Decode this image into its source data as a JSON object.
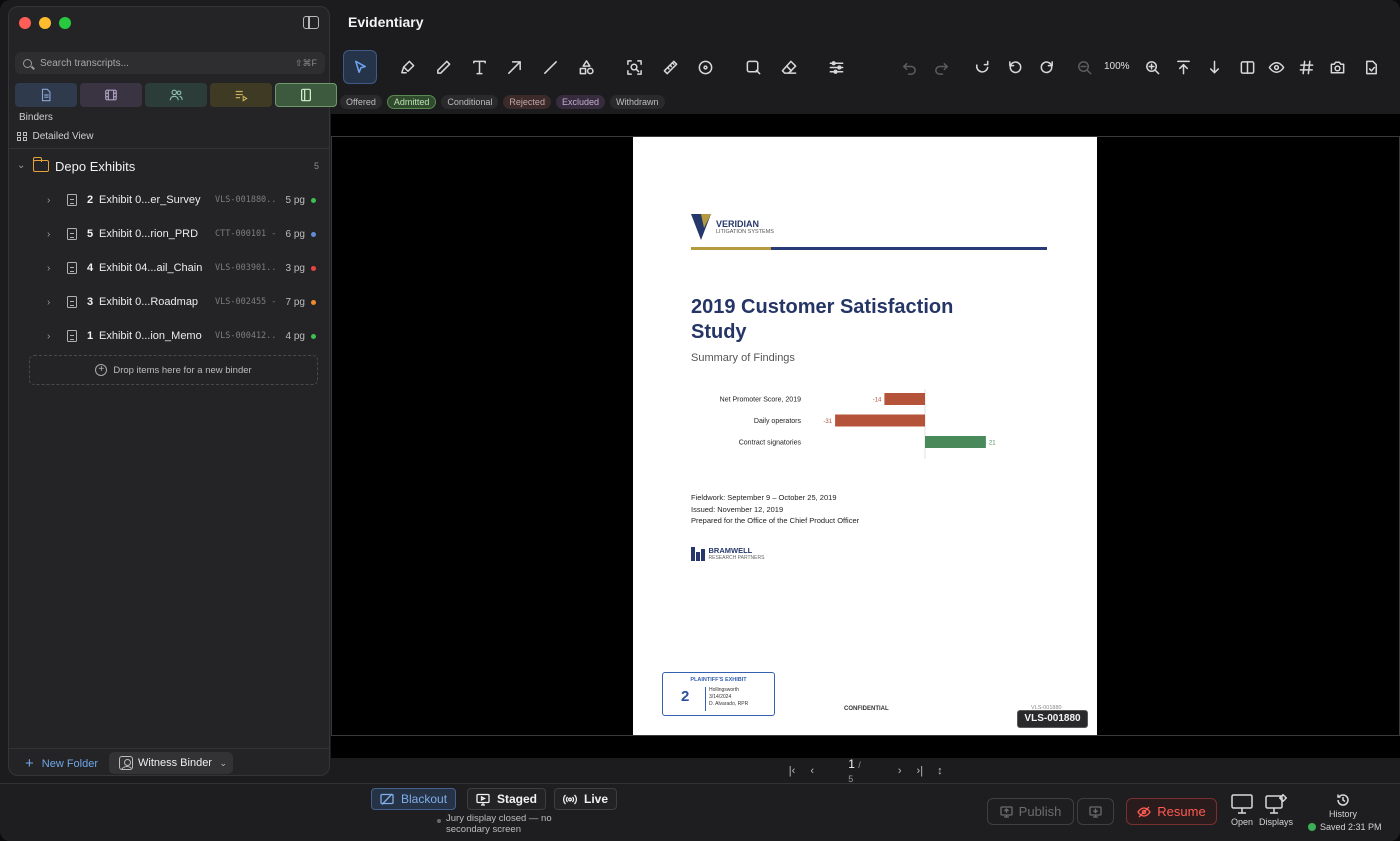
{
  "app": {
    "title": "Evidentiary"
  },
  "sidebar": {
    "search": {
      "placeholder": "Search transcripts...",
      "shortcut": "⇧⌘F"
    },
    "view_tabs": [
      "documents-icon",
      "film-icon",
      "people-icon",
      "playlist-icon",
      "binder-icon"
    ],
    "binders_label": "Binders",
    "detailed_view": "Detailed View",
    "folder": {
      "name": "Depo Exhibits",
      "count": "5",
      "items": [
        {
          "num": "2",
          "name": "Exhibit 0...er_Survey",
          "bates": "VLS-001880...",
          "pages": "5 pg",
          "color": "#3cc04f"
        },
        {
          "num": "5",
          "name": "Exhibit 0...rion_PRD",
          "bates": "CTT-000101 -...",
          "pages": "6 pg",
          "color": "#5f8bd8"
        },
        {
          "num": "4",
          "name": "Exhibit 04...ail_Chain",
          "bates": "VLS-003901...",
          "pages": "3 pg",
          "color": "#e8453c"
        },
        {
          "num": "3",
          "name": "Exhibit 0...Roadmap",
          "bates": "VLS-002455 -...",
          "pages": "7 pg",
          "color": "#f08a2c"
        },
        {
          "num": "1",
          "name": "Exhibit 0...ion_Memo",
          "bates": "VLS-000412...",
          "pages": "4 pg",
          "color": "#3cc04f"
        }
      ]
    },
    "drop_zone": "Drop items here for a new binder",
    "new_folder": "New Folder",
    "witness_binder": "Witness Binder"
  },
  "toolbar": {
    "zoom": "100%"
  },
  "statuses": [
    "Offered",
    "Admitted",
    "Conditional",
    "Rejected",
    "Excluded",
    "Withdrawn"
  ],
  "document": {
    "brand": "VERIDIAN",
    "brand_sub": "LITIGATION SYSTEMS",
    "title": "2019 Customer Satisfaction Study",
    "subtitle": "Summary of Findings",
    "meta": [
      "Fieldwork: September 9 – October 25, 2019",
      "Issued: November 12, 2019",
      "Prepared for the Office of the Chief Product Officer"
    ],
    "vendor": "BRAMWELL",
    "vendor_sub": "RESEARCH PARTNERS",
    "stamp": {
      "title": "PLAINTIFF'S EXHIBIT",
      "number": "2",
      "witness": "Hollingsworth",
      "date": "3/14/2024",
      "reporter": "D. Alvarado, RPR"
    },
    "confidential": "CONFIDENTIAL",
    "bates_faint": "VLS-001880",
    "bates": "VLS-001880"
  },
  "chart_data": {
    "type": "bar",
    "orientation": "horizontal",
    "categories": [
      "Net Promoter Score, 2019",
      "Daily operators",
      "Contract signatories"
    ],
    "values": [
      -14,
      -31,
      21
    ],
    "colors": {
      "negative": "#b5523a",
      "positive": "#4a8a5a"
    },
    "title": "",
    "xlabel": "",
    "ylabel": ""
  },
  "pager": {
    "current": "1",
    "total": "/ 5"
  },
  "modes": {
    "blackout": "Blackout",
    "staged": "Staged",
    "live": "Live"
  },
  "jury_note": "Jury display closed — no secondary screen",
  "actions": {
    "publish": "Publish",
    "resume": "Resume",
    "open": "Open",
    "displays": "Displays",
    "history": "History",
    "saved": "Saved 2:31 PM"
  }
}
